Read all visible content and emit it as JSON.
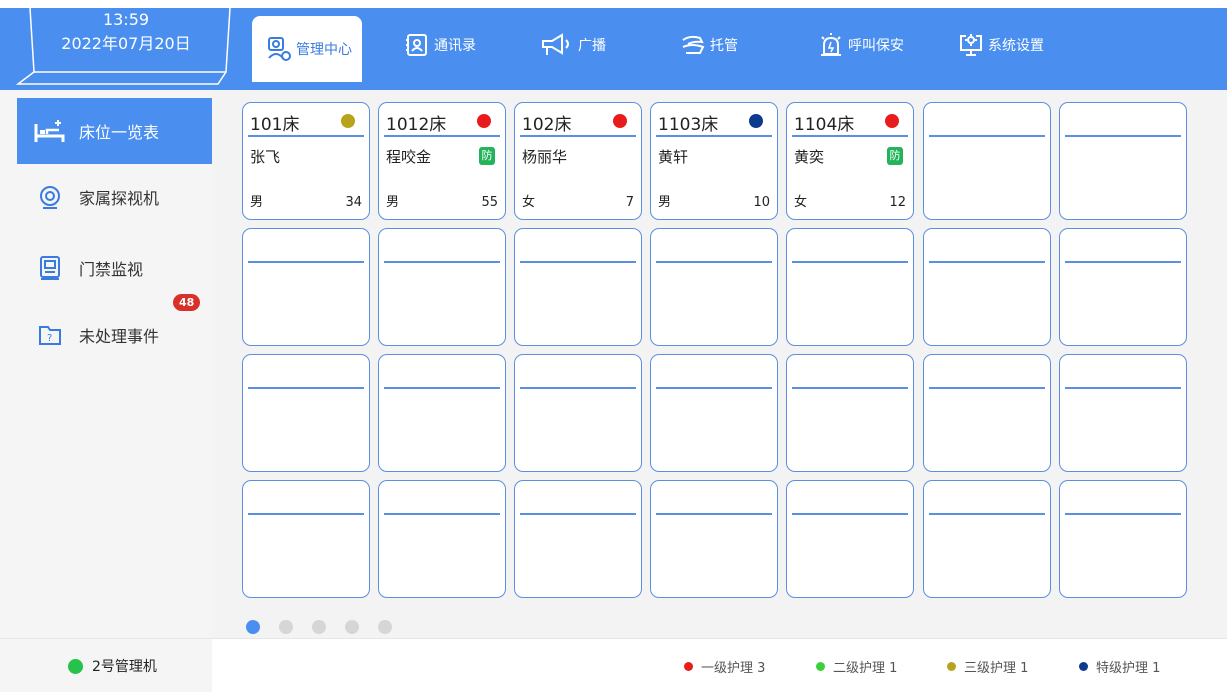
{
  "header": {
    "time": "13:59",
    "date": "2022年07月20日",
    "tabs": [
      {
        "label": "管理中心",
        "icon": "admin-icon",
        "active": true
      },
      {
        "label": "通讯录",
        "icon": "contacts-icon",
        "active": false
      },
      {
        "label": "广播",
        "icon": "broadcast-icon",
        "active": false
      },
      {
        "label": "托管",
        "icon": "hosting-icon",
        "active": false
      },
      {
        "label": "呼叫保安",
        "icon": "alarm-icon",
        "active": false
      },
      {
        "label": "系统设置",
        "icon": "settings-icon",
        "active": false
      }
    ]
  },
  "sidebar": {
    "items": [
      {
        "label": "床位一览表",
        "icon": "bed-icon",
        "active": true
      },
      {
        "label": "家属探视机",
        "icon": "camera-icon",
        "active": false
      },
      {
        "label": "门禁监视",
        "icon": "monitor-icon",
        "active": false
      },
      {
        "label": "未处理事件",
        "icon": "folder-icon",
        "active": false,
        "badge": "48"
      }
    ]
  },
  "beds": [
    {
      "bed": "101床",
      "dot_color": "#b8a41c",
      "name": "张飞",
      "fang": "",
      "gender": "男",
      "age": "34"
    },
    {
      "bed": "1012床",
      "dot_color": "#e81c1c",
      "name": "程咬金",
      "fang": "防",
      "gender": "男",
      "age": "55"
    },
    {
      "bed": "102床",
      "dot_color": "#e81c1c",
      "name": "杨丽华",
      "fang": "",
      "gender": "女",
      "age": "7"
    },
    {
      "bed": "1103床",
      "dot_color": "#0d3a8c",
      "name": "黄轩",
      "fang": "",
      "gender": "男",
      "age": "10"
    },
    {
      "bed": "1104床",
      "dot_color": "#e81c1c",
      "name": "黄奕",
      "fang": "防",
      "gender": "女",
      "age": "12"
    }
  ],
  "pager": {
    "pages": 5,
    "current": 1
  },
  "footer": {
    "machine": "2号管理机",
    "legend": [
      {
        "label": "一级护理 3",
        "color": "#e81c1c"
      },
      {
        "label": "二级护理 1",
        "color": "#3ccf3c"
      },
      {
        "label": "三级护理 1",
        "color": "#b8a41c"
      },
      {
        "label": "特级护理 1",
        "color": "#0d3a8c"
      }
    ]
  },
  "colors": {
    "accent": "#4a8ff0",
    "card_border": "#5b8fe0"
  }
}
